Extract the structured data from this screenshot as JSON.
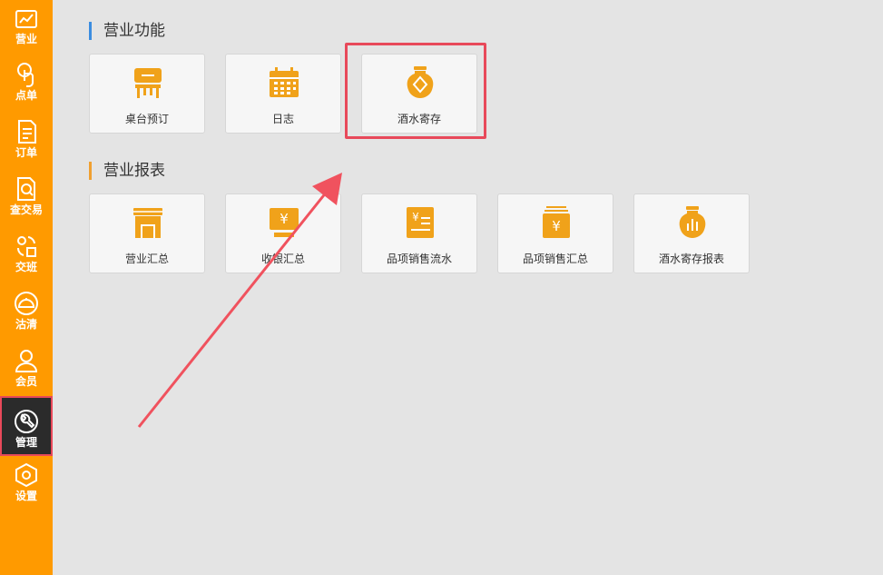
{
  "sidebar": {
    "items": [
      {
        "label": "营业",
        "icon": "chart-board-icon"
      },
      {
        "label": "点单",
        "icon": "hand-tap-icon"
      },
      {
        "label": "订单",
        "icon": "document-icon"
      },
      {
        "label": "查交易",
        "icon": "search-document-icon"
      },
      {
        "label": "交班",
        "icon": "shift-swap-icon"
      },
      {
        "label": "沽清",
        "icon": "dish-cover-icon"
      },
      {
        "label": "会员",
        "icon": "user-icon"
      },
      {
        "label": "管理",
        "icon": "wrench-icon",
        "active": true
      },
      {
        "label": "设置",
        "icon": "hexagon-gear-icon"
      }
    ]
  },
  "sections": {
    "functions": {
      "title": "营业功能",
      "cards": [
        {
          "label": "桌台预订",
          "icon": "table-icon"
        },
        {
          "label": "日志",
          "icon": "calendar-icon"
        },
        {
          "label": "酒水寄存",
          "icon": "wine-jar-icon"
        }
      ]
    },
    "reports": {
      "title": "营业报表",
      "cards": [
        {
          "label": "营业汇总",
          "icon": "storefront-icon"
        },
        {
          "label": "收银汇总",
          "icon": "cash-register-icon"
        },
        {
          "label": "品项销售流水",
          "icon": "receipt-icon"
        },
        {
          "label": "品项销售汇总",
          "icon": "money-stack-icon"
        },
        {
          "label": "酒水寄存报表",
          "icon": "jar-chart-icon"
        }
      ]
    }
  },
  "colors": {
    "sidebar": "#ff9a00",
    "icon": "#f0a21a",
    "highlight": "#e8495a",
    "active_nav": "#2b2b2b"
  }
}
